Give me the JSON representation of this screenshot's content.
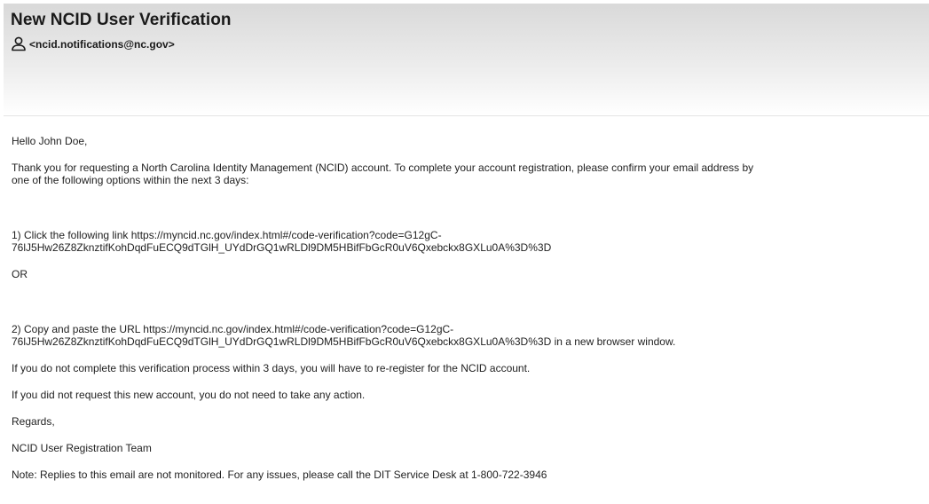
{
  "email": {
    "subject": "New NCID User Verification",
    "sender": "<ncid.notifications@nc.gov>",
    "sender_icon": "person-icon"
  },
  "body": {
    "greeting": "Hello John Doe,",
    "intro_line1": "Thank you for requesting a North Carolina Identity Management (NCID) account. To complete your account registration, please confirm your email address by",
    "intro_line2": "one of the following options within the next 3 days:",
    "option1_line1": "1) Click the following link https://myncid.nc.gov/index.html#/code-verification?code=G12gC-",
    "option1_line2": "76lJ5Hw26Z8ZknztifKohDqdFuECQ9dTGlH_UYdDrGQ1wRLDl9DM5HBifFbGcR0uV6Qxebckx8GXLu0A%3D%3D",
    "or": "OR",
    "option2_line1": "2) Copy and paste the URL https://myncid.nc.gov/index.html#/code-verification?code=G12gC-",
    "option2_line2": "76lJ5Hw26Z8ZknztifKohDqdFuECQ9dTGlH_UYdDrGQ1wRLDl9DM5HBifFbGcR0uV6Qxebckx8GXLu0A%3D%3D in a new browser window.",
    "reregister": "If you do not complete this verification process within 3 days, you will have to re-register for the NCID account.",
    "no_action": "If you did not request this new account, you do not need to take any action.",
    "regards": "Regards,",
    "team": "NCID User Registration Team",
    "note": "Note: Replies to this email are not monitored. For any issues, please call the DIT Service Desk at 1-800-722-3946"
  }
}
